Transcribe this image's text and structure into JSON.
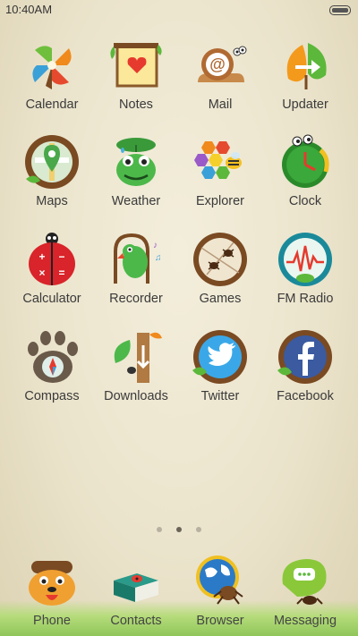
{
  "status_bar": {
    "time": "10:40AM"
  },
  "apps": [
    {
      "id": "calendar",
      "label": "Calendar",
      "icon": "calendar-icon"
    },
    {
      "id": "notes",
      "label": "Notes",
      "icon": "notes-icon"
    },
    {
      "id": "mail",
      "label": "Mail",
      "icon": "mail-icon"
    },
    {
      "id": "updater",
      "label": "Updater",
      "icon": "updater-icon"
    },
    {
      "id": "maps",
      "label": "Maps",
      "icon": "maps-icon"
    },
    {
      "id": "weather",
      "label": "Weather",
      "icon": "weather-icon"
    },
    {
      "id": "explorer",
      "label": "Explorer",
      "icon": "explorer-icon"
    },
    {
      "id": "clock",
      "label": "Clock",
      "icon": "clock-icon"
    },
    {
      "id": "calculator",
      "label": "Calculator",
      "icon": "calculator-icon"
    },
    {
      "id": "recorder",
      "label": "Recorder",
      "icon": "recorder-icon"
    },
    {
      "id": "games",
      "label": "Games",
      "icon": "games-icon"
    },
    {
      "id": "fm_radio",
      "label": "FM Radio",
      "icon": "fm-radio-icon"
    },
    {
      "id": "compass",
      "label": "Compass",
      "icon": "compass-icon"
    },
    {
      "id": "downloads",
      "label": "Downloads",
      "icon": "downloads-icon"
    },
    {
      "id": "twitter",
      "label": "Twitter",
      "icon": "twitter-icon"
    },
    {
      "id": "facebook",
      "label": "Facebook",
      "icon": "facebook-icon"
    }
  ],
  "page_indicator": {
    "count": 3,
    "active_index": 1
  },
  "dock": [
    {
      "id": "phone",
      "label": "Phone",
      "icon": "phone-icon"
    },
    {
      "id": "contacts",
      "label": "Contacts",
      "icon": "contacts-icon"
    },
    {
      "id": "browser",
      "label": "Browser",
      "icon": "browser-icon"
    },
    {
      "id": "messaging",
      "label": "Messaging",
      "icon": "messaging-icon"
    }
  ],
  "colors": {
    "label": "#3a3a3a",
    "ring_brown": "#7a4a22",
    "leaf_green": "#5cb83a",
    "accent_red": "#e0302a"
  }
}
